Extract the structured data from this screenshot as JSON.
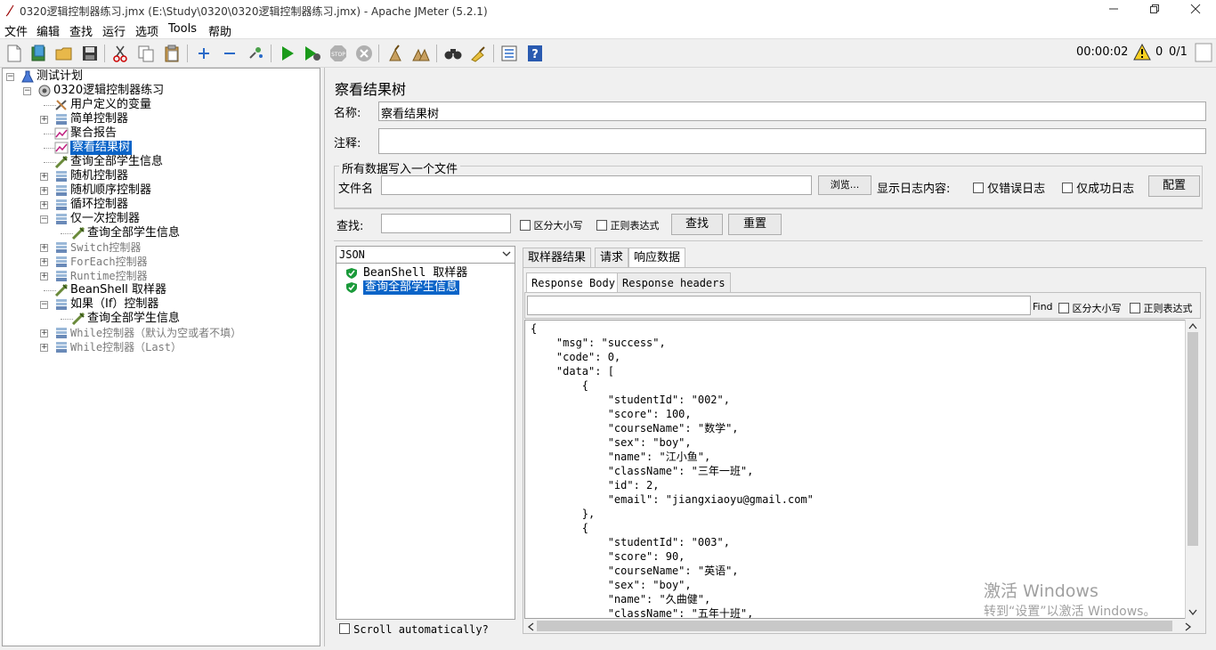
{
  "window": {
    "title": "0320逻辑控制器练习.jmx (E:\\Study\\0320\\0320逻辑控制器练习.jmx) - Apache JMeter (5.2.1)"
  },
  "menu": [
    "文件",
    "编辑",
    "查找",
    "运行",
    "选项",
    "Tools",
    "帮助"
  ],
  "toolbar": {
    "timer": "00:00:02",
    "warning_count": "0",
    "thread_count": "0/1"
  },
  "tree": [
    {
      "label": "测试计划",
      "icon": "test-plan-icon",
      "expander": "−"
    },
    {
      "label": "0320逻辑控制器练习",
      "icon": "thread-group-icon",
      "expander": "−"
    },
    {
      "label": "用户定义的变量",
      "icon": "wrench-icon",
      "expander": ""
    },
    {
      "label": "简单控制器",
      "icon": "controller-icon",
      "expander": "+"
    },
    {
      "label": "聚合报告",
      "icon": "report-icon",
      "expander": ""
    },
    {
      "label": "察看结果树",
      "icon": "report-icon",
      "expander": ""
    },
    {
      "label": "查询全部学生信息",
      "icon": "sampler-icon",
      "expander": ""
    },
    {
      "label": "随机控制器",
      "icon": "controller-icon",
      "expander": "+"
    },
    {
      "label": "随机顺序控制器",
      "icon": "controller-icon",
      "expander": "+"
    },
    {
      "label": "循环控制器",
      "icon": "controller-icon",
      "expander": "+"
    },
    {
      "label": "仅一次控制器",
      "icon": "controller-icon",
      "expander": "−"
    },
    {
      "label": "查询全部学生信息",
      "icon": "sampler-icon",
      "expander": ""
    },
    {
      "label": "Switch控制器",
      "icon": "controller-icon",
      "expander": "+"
    },
    {
      "label": "ForEach控制器",
      "icon": "controller-icon",
      "expander": "+"
    },
    {
      "label": "Runtime控制器",
      "icon": "controller-icon",
      "expander": "+"
    },
    {
      "label": "BeanShell 取样器",
      "icon": "sampler-icon",
      "expander": ""
    },
    {
      "label": "如果（If）控制器",
      "icon": "controller-icon",
      "expander": "−"
    },
    {
      "label": "查询全部学生信息",
      "icon": "sampler-icon",
      "expander": ""
    },
    {
      "label": "While控制器（默认为空或者不填）",
      "icon": "controller-icon",
      "expander": "+"
    },
    {
      "label": "While控制器（Last）",
      "icon": "controller-icon",
      "expander": "+"
    }
  ],
  "panel": {
    "title": "察看结果树",
    "name_label": "名称:",
    "name_value": "察看结果树",
    "comment_label": "注释:",
    "comment_value": "",
    "file_section": "所有数据写入一个文件",
    "file_label": "文件名",
    "file_value": "",
    "browse_btn": "浏览...",
    "log_label": "显示日志内容:",
    "errors_only": "仅错误日志",
    "success_only": "仅成功日志",
    "config_btn": "配置",
    "search_label": "查找:",
    "search_value": "",
    "case_sensitive": "区分大小写",
    "regex": "正则表达式",
    "find_btn": "查找",
    "reset_btn": "重置"
  },
  "results": {
    "renderer": "JSON",
    "items": [
      "BeanShell 取样器",
      "查询全部学生信息"
    ],
    "scroll_auto": "Scroll automatically?",
    "tabs": [
      "取样器结果",
      "请求",
      "响应数据"
    ],
    "subtabs": [
      "Response Body",
      "Response headers"
    ],
    "find_label": "Find",
    "find_case": "区分大小写",
    "find_regex": "正则表达式",
    "json_lines": [
      "{",
      "    \"msg\": \"success\",",
      "    \"code\": 0,",
      "    \"data\": [",
      "        {",
      "            \"studentId\": \"002\",",
      "            \"score\": 100,",
      "            \"courseName\": \"数学\",",
      "            \"sex\": \"boy\",",
      "            \"name\": \"江小鱼\",",
      "            \"className\": \"三年一班\",",
      "            \"id\": 2,",
      "            \"email\": \"jiangxiaoyu@gmail.com\"",
      "        },",
      "        {",
      "            \"studentId\": \"003\",",
      "            \"score\": 90,",
      "            \"courseName\": \"英语\",",
      "            \"sex\": \"boy\",",
      "            \"name\": \"久曲健\",",
      "            \"className\": \"五年十班\","
    ]
  },
  "watermark": {
    "line1": "激活 Windows",
    "line2": "转到“设置”以激活 Windows。"
  }
}
